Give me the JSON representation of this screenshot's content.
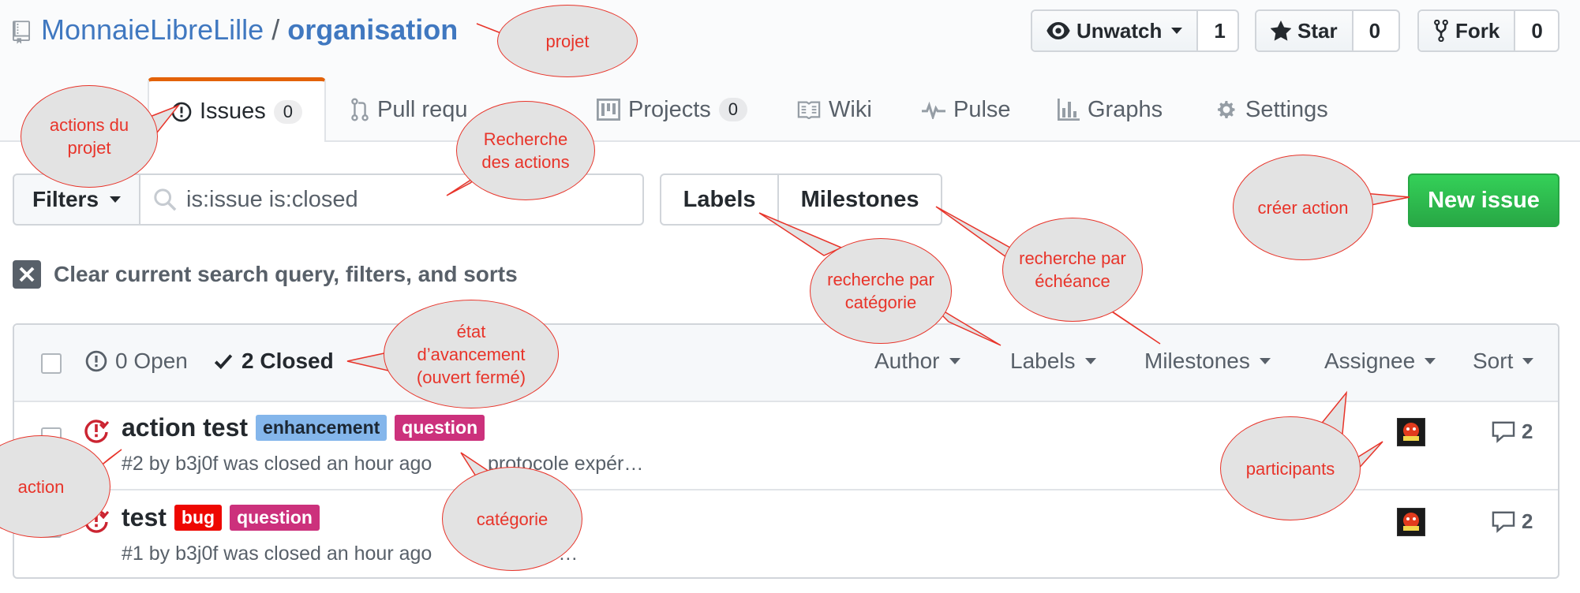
{
  "repo": {
    "owner": "MonnaieLibreLille",
    "separator": "/",
    "name": "organisation"
  },
  "header_buttons": [
    {
      "label": "Unwatch",
      "count": "1",
      "icon": "eye-icon"
    },
    {
      "label": "Star",
      "count": "0",
      "icon": "star-icon"
    },
    {
      "label": "Fork",
      "count": "0",
      "icon": "fork-icon"
    }
  ],
  "tabs": [
    {
      "label": "Issues",
      "count": "0",
      "icon": "issue-opened-icon",
      "selected": true
    },
    {
      "label": "Pull requ",
      "icon": "git-pull-request-icon"
    },
    {
      "label": "Projects",
      "count": "0",
      "icon": "project-icon"
    },
    {
      "label": "Wiki",
      "icon": "book-icon"
    },
    {
      "label": "Pulse",
      "icon": "pulse-icon"
    },
    {
      "label": "Graphs",
      "icon": "graph-icon"
    },
    {
      "label": "Settings",
      "icon": "gear-icon"
    }
  ],
  "filter_bar": {
    "filters_label": "Filters",
    "search_value": "is:issue is:closed",
    "labels_label": "Labels",
    "milestones_label": "Milestones",
    "new_issue_label": "New issue"
  },
  "clear_query_label": "Clear current search query, filters, and sorts",
  "issues_header": {
    "open_label": "0 Open",
    "closed_label": "2 Closed",
    "filters": [
      "Author",
      "Labels",
      "Milestones",
      "Assignee",
      "Sort"
    ]
  },
  "issues": [
    {
      "title": "action test",
      "labels": [
        {
          "name": "enhancement",
          "bg": "#84b6eb",
          "fg": "#1c2733"
        },
        {
          "name": "question",
          "bg": "#cc317c",
          "fg": "#ffffff"
        }
      ],
      "meta": "#2 by b3j0f was closed an hour ago",
      "milestone": "protocole expér…",
      "comments": "2"
    },
    {
      "title": "test",
      "labels": [
        {
          "name": "bug",
          "bg": "#ee0701",
          "fg": "#ffffff"
        },
        {
          "name": "question",
          "bg": "#cc317c",
          "fg": "#ffffff"
        }
      ],
      "meta": "#1 by b3j0f was closed an hour ago",
      "milestone": "e expér…",
      "comments": "2"
    }
  ],
  "annotations": {
    "projet": "projet",
    "actions_projet": [
      "actions du",
      "projet"
    ],
    "recherche_actions": [
      "Recherche",
      "des actions"
    ],
    "creer_action": "créer action",
    "recherche_categorie": [
      "recherche par",
      "catégorie"
    ],
    "recherche_echeance": [
      "recherche par",
      "échéance"
    ],
    "etat": [
      "état",
      "d’avancement",
      "(ouvert fermé)"
    ],
    "action": "action",
    "categorie": "catégorie",
    "participants": "participants"
  },
  "colors": {
    "accent_orange": "#e36209",
    "link_blue": "#4078c0",
    "green": "#28a745",
    "annotation_red": "#e8342a",
    "closed_red": "#cb2431"
  }
}
